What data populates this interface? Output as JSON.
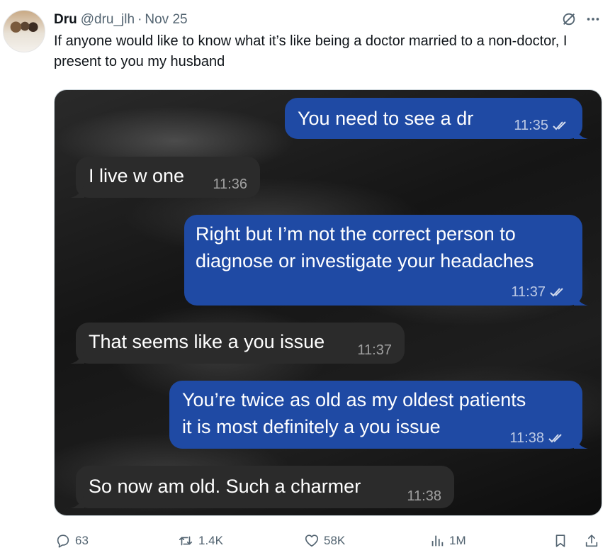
{
  "tweet": {
    "display_name": "Dru",
    "handle": "@dru_jlh",
    "separator": "·",
    "date": "Nov 25",
    "text": "If anyone would like to know what it’s like being a doctor married to a non-doctor, I present to you my husband"
  },
  "messages": [
    {
      "direction": "outgoing",
      "text": "You need to see a dr",
      "time": "11:35",
      "read_receipt": "double-check-icon"
    },
    {
      "direction": "incoming",
      "text": "I live w one",
      "time": "11:36"
    },
    {
      "direction": "outgoing",
      "text": "Right but I’m not the correct person to\ndiagnose or investigate your headaches",
      "time": "11:37",
      "read_receipt": "double-check-icon"
    },
    {
      "direction": "incoming",
      "text": "That seems like a you issue",
      "time": "11:37"
    },
    {
      "direction": "outgoing",
      "text": "You’re twice as old as my oldest patients\nit is most definitely a you issue",
      "time": "11:38",
      "read_receipt": "double-check-icon"
    },
    {
      "direction": "incoming",
      "text": "So now am old. Such a charmer",
      "time": "11:38"
    }
  ],
  "actions": {
    "replies": "63",
    "reposts": "1.4K",
    "likes": "58K",
    "views": "1M"
  },
  "colors": {
    "outgoing_bubble": "#1f4aa4",
    "incoming_bubble": "#2b2b2b",
    "secondary_text": "#536471"
  }
}
